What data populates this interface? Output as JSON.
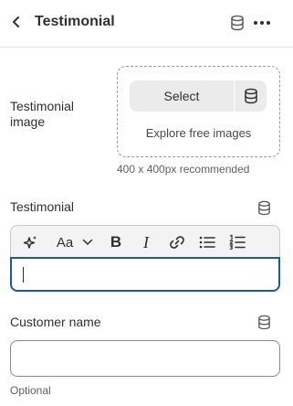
{
  "header": {
    "title": "Testimonial",
    "back_icon": "chevron-left-icon",
    "db_icon": "database-icon",
    "more_icon": "more-horizontal-icon"
  },
  "image_field": {
    "label": "Testimonial image",
    "select_label": "Select",
    "explore_label": "Explore free images",
    "hint": "400 x 400px recommended"
  },
  "testimonial_field": {
    "label": "Testimonial",
    "value": "",
    "toolbar": [
      {
        "name": "ai-sparkle",
        "icon": "sparkle-icon"
      },
      {
        "name": "font-style",
        "icon": "font-style-icon",
        "text": "Aa"
      },
      {
        "name": "bold",
        "icon": "bold-icon",
        "text": "B"
      },
      {
        "name": "italic",
        "icon": "italic-icon",
        "text": "I"
      },
      {
        "name": "link",
        "icon": "link-icon"
      },
      {
        "name": "bulleted-list",
        "icon": "bullet-list-icon"
      },
      {
        "name": "numbered-list",
        "icon": "numbered-list-icon"
      }
    ]
  },
  "customer_field": {
    "label": "Customer name",
    "value": "",
    "placeholder": "",
    "help": "Optional"
  },
  "colors": {
    "focus": "#1a56b4",
    "text": "#303030",
    "muted": "#616161",
    "button_bg": "#ebebeb"
  }
}
